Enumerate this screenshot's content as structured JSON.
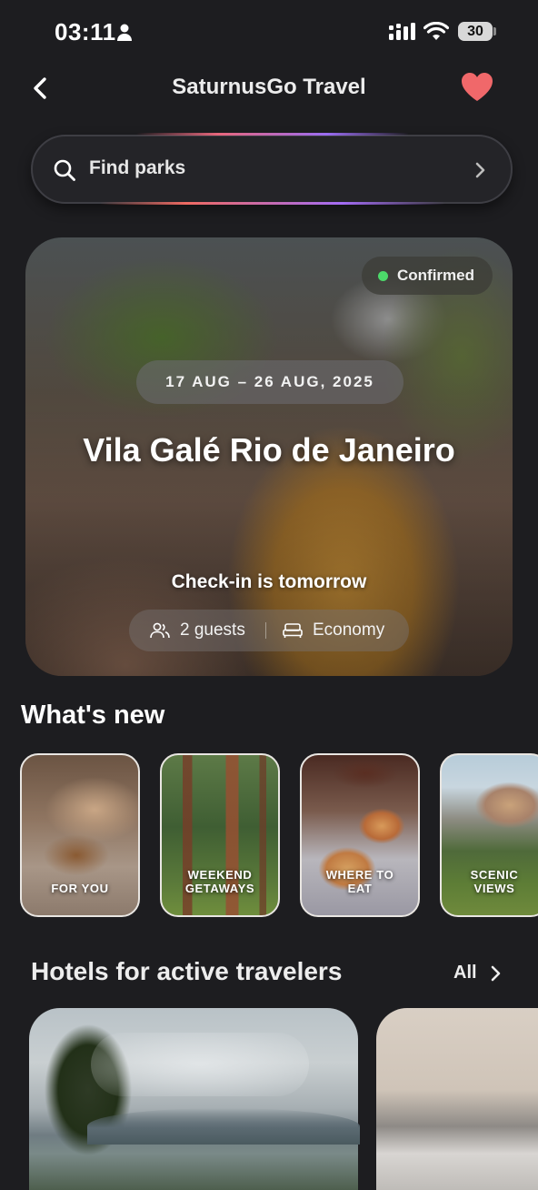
{
  "status_bar": {
    "time": "03:11",
    "battery": "30"
  },
  "header": {
    "title": "SaturnusGo Travel"
  },
  "search": {
    "placeholder": "Find parks"
  },
  "booking": {
    "status": "Confirmed",
    "dates": "17 AUG – 26 AUG, 2025",
    "hotel_name": "Vila Galé Rio de Janeiro",
    "checkin_note": "Check-in is tomorrow",
    "guests": "2 guests",
    "room_class": "Economy"
  },
  "whats_new": {
    "title": "What's new",
    "tiles": [
      {
        "label": "FOR YOU"
      },
      {
        "label": "WEEKEND GETAWAYS"
      },
      {
        "label": "WHERE TO EAT"
      },
      {
        "label": "SCENIC VIEWS"
      }
    ]
  },
  "hotels_section": {
    "title": "Hotels for active travelers",
    "all_label": "All"
  },
  "colors": {
    "background": "#1d1d20",
    "favorite": "#f0686a",
    "confirmed_dot": "#4cd96a"
  }
}
